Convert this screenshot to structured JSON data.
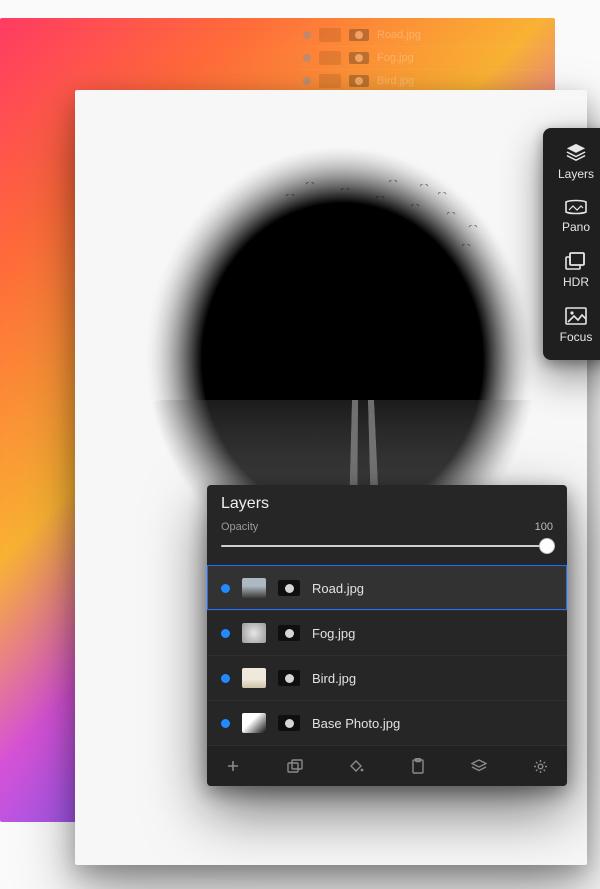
{
  "bg_ghost_layers": [
    "Road.jpg",
    "Fog.jpg",
    "Bird.jpg"
  ],
  "toolbar": {
    "layers_label": "Layers",
    "pano_label": "Pano",
    "hdr_label": "HDR",
    "focus_label": "Focus"
  },
  "layers_panel": {
    "title": "Layers",
    "opacity_label": "Opacity",
    "opacity_value": "100",
    "layers": [
      {
        "name": "Road.jpg",
        "selected": true
      },
      {
        "name": "Fog.jpg",
        "selected": false
      },
      {
        "name": "Bird.jpg",
        "selected": false
      },
      {
        "name": "Base Photo.jpg",
        "selected": false
      }
    ]
  }
}
